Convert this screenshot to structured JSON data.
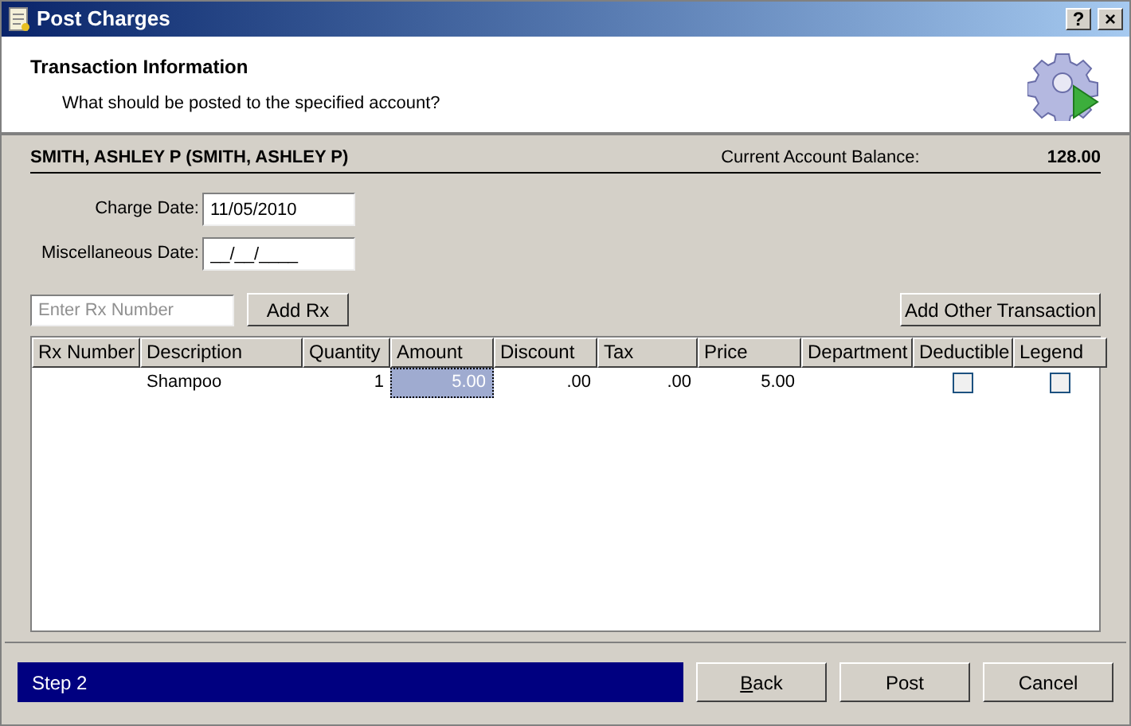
{
  "window": {
    "title": "Post Charges",
    "help": "?",
    "close": "×"
  },
  "header": {
    "title": "Transaction Information",
    "subtitle": "What should be posted to the specified account?"
  },
  "account": {
    "name": "SMITH, ASHLEY P (SMITH, ASHLEY P)",
    "balance_label": "Current Account Balance:",
    "balance": "128.00"
  },
  "fields": [
    {
      "label": "Charge Date:",
      "value": "11/05/2010"
    },
    {
      "label": "Miscellaneous Date:",
      "value": "__/__/____"
    }
  ],
  "rx": {
    "placeholder": "Enter Rx Number",
    "add_button": "Add Rx",
    "other_button": "Add Other Transaction"
  },
  "table": {
    "columns": [
      "Rx Number",
      "Description",
      "Quantity",
      "Amount",
      "Discount",
      "Tax",
      "Price",
      "Department",
      "Deductible",
      "Legend"
    ],
    "rows": [
      {
        "cells": [
          {
            "kind": "empty"
          },
          {
            "kind": "text",
            "text": "Shampoo",
            "selected": false
          },
          {
            "kind": "num",
            "text": "1",
            "selected": false
          },
          {
            "kind": "num",
            "text": "5.00",
            "selected": true
          },
          {
            "kind": "num",
            "text": ".00",
            "selected": false
          },
          {
            "kind": "num",
            "text": ".00",
            "selected": false
          },
          {
            "kind": "num",
            "text": "5.00",
            "selected": false
          },
          {
            "kind": "empty"
          },
          {
            "kind": "check",
            "checked": false,
            "selected": false
          },
          {
            "kind": "check",
            "checked": false,
            "selected": false
          }
        ]
      }
    ]
  },
  "footer": {
    "step": "Step 2",
    "buttons": [
      {
        "label": "Back",
        "mnemonic": true
      },
      {
        "label": "Post",
        "mnemonic": false
      },
      {
        "label": "Cancel",
        "mnemonic": false
      }
    ]
  }
}
